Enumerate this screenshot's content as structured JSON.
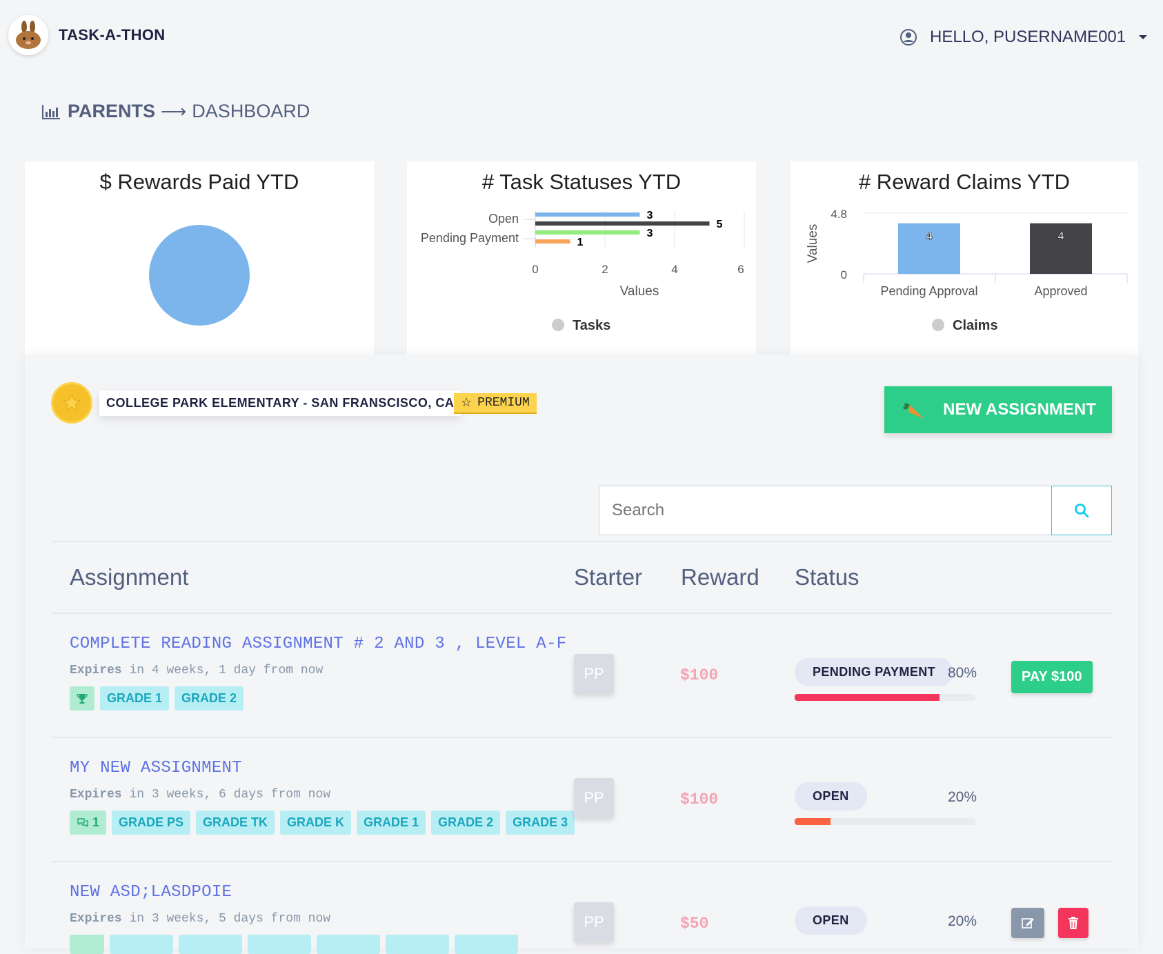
{
  "header": {
    "app_title": "TASK-A-THON",
    "user_greeting": "HELLO, PUSERNAME001"
  },
  "breadcrumb": {
    "section": "PARENTS",
    "page": "DASHBOARD"
  },
  "cards": [
    {
      "title": "$ Rewards Paid YTD"
    },
    {
      "title": "# Task Statuses YTD"
    },
    {
      "title": "# Reward Claims YTD"
    }
  ],
  "chart_data": [
    {
      "type": "pie",
      "title": "$ Rewards Paid YTD",
      "values": [
        1
      ],
      "colors": [
        "#7cb5ec"
      ]
    },
    {
      "type": "bar",
      "orientation": "horizontal",
      "title": "# Task Statuses YTD",
      "categories": [
        "Open",
        "Pending Payment"
      ],
      "series": [
        {
          "values": [
            3
          ],
          "color": "#7cb5ec"
        },
        {
          "values": [
            5
          ],
          "color": "#434348"
        },
        {
          "values": [
            3
          ],
          "color": "#90ed7d"
        },
        {
          "values": [
            1
          ],
          "color": "#f7a35c"
        }
      ],
      "bar_values": [
        3,
        5,
        3,
        1
      ],
      "bar_colors": [
        "#7cb5ec",
        "#434348",
        "#90ed7d",
        "#f7a35c"
      ],
      "x_ticks": [
        "0",
        "2",
        "4",
        "6"
      ],
      "xlabel": "Values",
      "xlim": [
        0,
        6
      ],
      "legend": "Tasks",
      "legend_position": "bottom"
    },
    {
      "type": "bar",
      "title": "# Reward Claims YTD",
      "categories": [
        "Pending Approval",
        "Approved"
      ],
      "values": [
        4,
        4
      ],
      "colors": [
        "#7cb5ec",
        "#434348"
      ],
      "y_ticks": [
        "0",
        "4.8"
      ],
      "ylabel": "Values",
      "ylim": [
        0,
        4.8
      ],
      "legend": "Claims",
      "legend_position": "bottom"
    }
  ],
  "school": {
    "name": "COLLEGE PARK ELEMENTARY - SAN FRANSCISCO, CA",
    "badge": "PREMIUM"
  },
  "new_assignment_label": "NEW ASSIGNMENT",
  "search": {
    "placeholder": "Search",
    "value": ""
  },
  "table": {
    "headers": {
      "assignment": "Assignment",
      "starter": "Starter",
      "reward": "Reward",
      "status": "Status"
    },
    "rows": [
      {
        "title": "COMPLETE READING ASSIGNMENT # 2 AND 3 , LEVEL A-F",
        "expires_label": "Expires",
        "expires_text": "in 4 weeks, 1 day from now",
        "badge_count": "",
        "tags": [
          "GRADE 1",
          "GRADE 2"
        ],
        "starter": "PP",
        "reward": "$100",
        "status": "PENDING PAYMENT",
        "progress_label": "80%",
        "progress": 0.8,
        "progress_color": "#f5365c",
        "action": "PAY $100"
      },
      {
        "title": "MY NEW ASSIGNMENT",
        "expires_label": "Expires",
        "expires_text": "in 3 weeks, 6 days from now",
        "badge_count": "1",
        "tags": [
          "GRADE PS",
          "GRADE TK",
          "GRADE K",
          "GRADE 1",
          "GRADE 2",
          "GRADE 3"
        ],
        "starter": "PP",
        "reward": "$100",
        "status": "OPEN",
        "progress_label": "20%",
        "progress": 0.2,
        "progress_color": "#fb6340"
      },
      {
        "title": "NEW ASD;LASDPOIE",
        "expires_label": "Expires",
        "expires_text": "in 3 weeks, 5 days from now",
        "starter": "PP",
        "reward": "$50",
        "status": "OPEN",
        "progress_label": "20%",
        "progress": 0.2,
        "progress_color": "#fb6340"
      }
    ]
  }
}
